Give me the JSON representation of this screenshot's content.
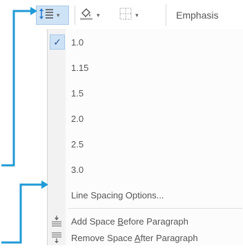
{
  "ribbon": {
    "line_spacing_caret": "▾",
    "shading_caret": "▾",
    "borders_caret": "▾",
    "style_label": "Emphasis",
    "icons": [
      "line-spacing-icon",
      "shading-icon",
      "borders-icon"
    ]
  },
  "menu": {
    "spacing_options": [
      "1.0",
      "1.15",
      "1.5",
      "2.0",
      "2.5",
      "3.0"
    ],
    "selected_option": "1.0",
    "line_spacing_options": "Line Spacing Options...",
    "add_space_before": {
      "pre": "Add Space ",
      "key": "B",
      "post": "efore Paragraph"
    },
    "remove_space_after": {
      "pre": "Remove Space ",
      "key": "A",
      "post": "fter Paragraph"
    }
  },
  "colors": {
    "accent": "#1f9ad6",
    "selection": "#cde2f5",
    "selection_border": "#a7c8e8"
  }
}
